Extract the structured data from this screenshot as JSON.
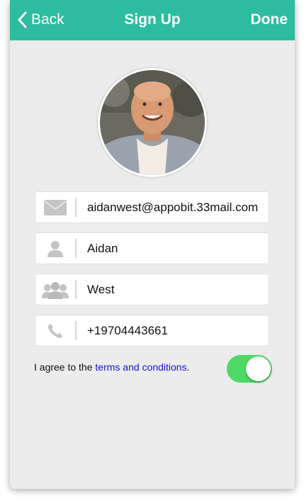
{
  "navbar": {
    "back_label": "Back",
    "title": "Sign Up",
    "done_label": "Done"
  },
  "avatar": {
    "icon": "profile-photo"
  },
  "fields": [
    {
      "name": "email",
      "icon": "mail-icon",
      "value": "aidanwest@appobit.33mail.com"
    },
    {
      "name": "first_name",
      "icon": "user-icon",
      "value": "Aidan"
    },
    {
      "name": "last_name",
      "icon": "users-icon",
      "value": "West"
    },
    {
      "name": "phone",
      "icon": "phone-icon",
      "value": "+19704443661"
    }
  ],
  "terms": {
    "prefix": "I agree to the ",
    "link_text": "terms and conditions",
    "suffix": ".",
    "agreed": true
  },
  "colors": {
    "navbar_bg": "#2dbc9f",
    "toggle_on": "#4cd964",
    "link": "#1a13d8"
  }
}
